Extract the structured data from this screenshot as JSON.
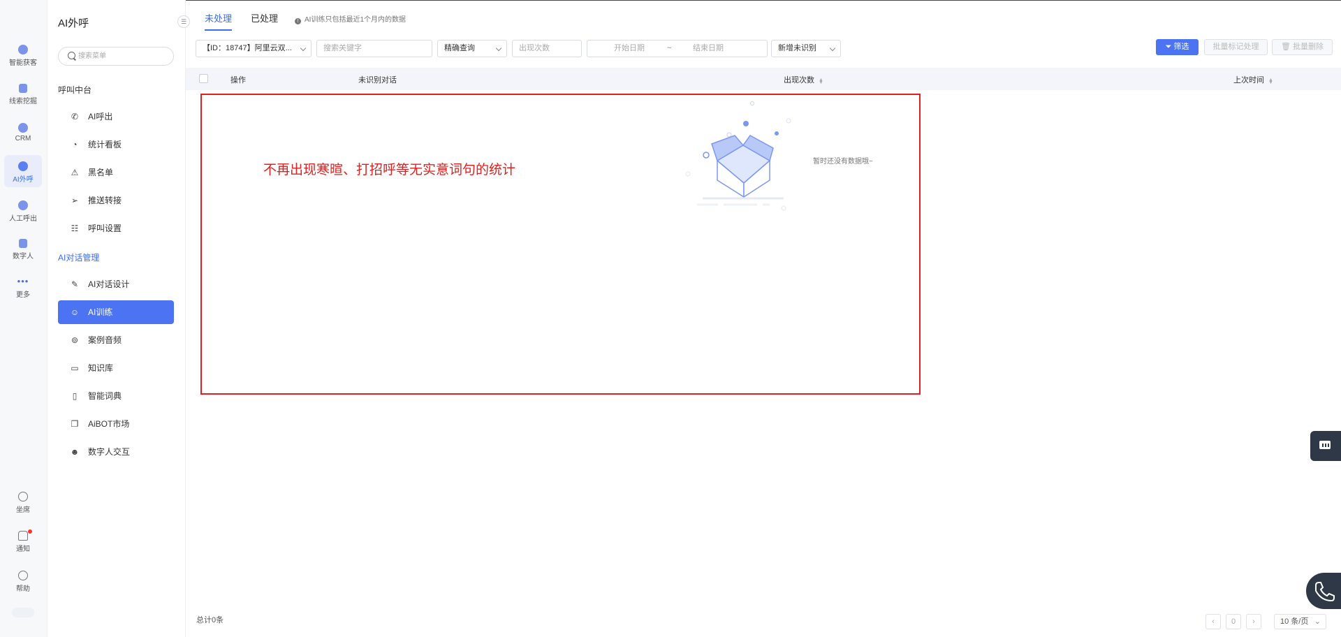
{
  "left_nav": {
    "items": [
      {
        "label": "智能获客",
        "icon": "growth-icon"
      },
      {
        "label": "线索挖掘",
        "icon": "document-icon"
      },
      {
        "label": "CRM",
        "icon": "crm-icon"
      },
      {
        "label": "AI外呼",
        "icon": "robot-icon"
      },
      {
        "label": "人工呼出",
        "icon": "headset-icon"
      },
      {
        "label": "数字人",
        "icon": "video-icon"
      },
      {
        "label": "更多",
        "icon": "more-dots-icon"
      }
    ],
    "bottom": [
      {
        "label": "坐席",
        "icon": "agent-icon"
      },
      {
        "label": "通知",
        "icon": "bell-icon"
      },
      {
        "label": "帮助",
        "icon": "help-icon"
      }
    ],
    "accent": "#3d6df2"
  },
  "sidebar": {
    "title": "AI外呼",
    "search_placeholder": "搜索菜单",
    "sections": [
      {
        "title": "呼叫中台",
        "items": [
          {
            "label": "AI呼出",
            "icon": "phone-icon"
          },
          {
            "label": "统计看板",
            "icon": "pie-chart-icon"
          },
          {
            "label": "黑名单",
            "icon": "warning-icon"
          },
          {
            "label": "推送转接",
            "icon": "send-icon"
          },
          {
            "label": "呼叫设置",
            "icon": "sliders-icon"
          }
        ]
      },
      {
        "title": "AI对话管理",
        "items": [
          {
            "label": "AI对话设计",
            "icon": "pen-icon"
          },
          {
            "label": "AI训练",
            "icon": "smile-icon"
          },
          {
            "label": "案例音频",
            "icon": "tape-icon"
          },
          {
            "label": "知识库",
            "icon": "laptop-icon"
          },
          {
            "label": "智能词典",
            "icon": "book-icon"
          },
          {
            "label": "AiBOT市场",
            "icon": "chat-window-icon"
          },
          {
            "label": "数字人交互",
            "icon": "avatar-icon"
          }
        ]
      }
    ]
  },
  "tabs": {
    "pending": "未处理",
    "processed": "已处理",
    "hint": "AI训练只包括最近1个月内的数据"
  },
  "filters": {
    "bot_select": "【ID：18747】阿里云双...",
    "keyword_placeholder": "搜索关键字",
    "match_mode": "精确查询",
    "count_placeholder": "出现次数",
    "start_date_placeholder": "开始日期",
    "date_separator": "~",
    "end_date_placeholder": "结束日期",
    "type_select": "新增未识别",
    "filter_button": "筛选",
    "batch_mark_button": "批量标记处理",
    "batch_delete_button": "批量删除"
  },
  "table": {
    "columns": [
      "操作",
      "未识别对话",
      "出现次数",
      "上次时间"
    ],
    "rows": [],
    "empty_text": "暂时还没有数据哦~"
  },
  "annotation": "不再出现寒暄、打招呼等无实意词句的统计",
  "pagination": {
    "total": "总计0条",
    "current_page": "0",
    "page_size": "10 条/页"
  }
}
